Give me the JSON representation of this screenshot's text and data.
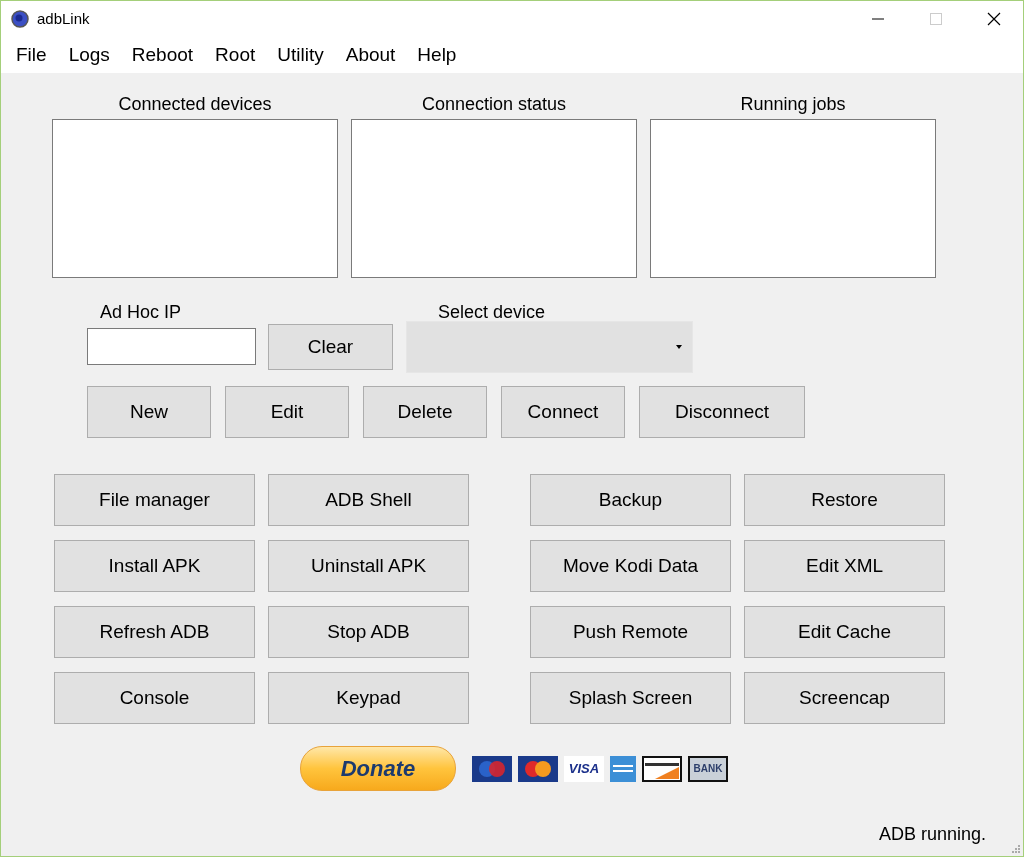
{
  "window": {
    "title": "adbLink",
    "maximize_disabled": true
  },
  "menu": [
    "File",
    "Logs",
    "Reboot",
    "Root",
    "Utility",
    "About",
    "Help"
  ],
  "panels": [
    {
      "title": "Connected devices"
    },
    {
      "title": "Connection status"
    },
    {
      "title": "Running jobs"
    }
  ],
  "adhoc": {
    "label": "Ad Hoc IP",
    "clear_button": "Clear"
  },
  "select_device": {
    "label": "Select device"
  },
  "device_buttons": [
    "New",
    "Edit",
    "Delete",
    "Connect",
    "Disconnect"
  ],
  "action_buttons": [
    [
      "File manager",
      "ADB Shell",
      "Backup",
      "Restore"
    ],
    [
      "Install APK",
      "Uninstall APK",
      "Move Kodi Data",
      "Edit XML"
    ],
    [
      "Refresh ADB",
      "Stop ADB",
      "Push Remote",
      "Edit Cache"
    ],
    [
      "Console",
      "Keypad",
      "Splash Screen",
      "Screencap"
    ]
  ],
  "donate": {
    "label": "Donate"
  },
  "cards": [
    {
      "kind": "maestro"
    },
    {
      "kind": "mastercard"
    },
    {
      "kind": "text",
      "label": "VISA"
    },
    {
      "kind": "amex"
    },
    {
      "kind": "discover"
    },
    {
      "kind": "text",
      "label": "BANK"
    }
  ],
  "status_bar": {
    "text": "ADB running."
  }
}
